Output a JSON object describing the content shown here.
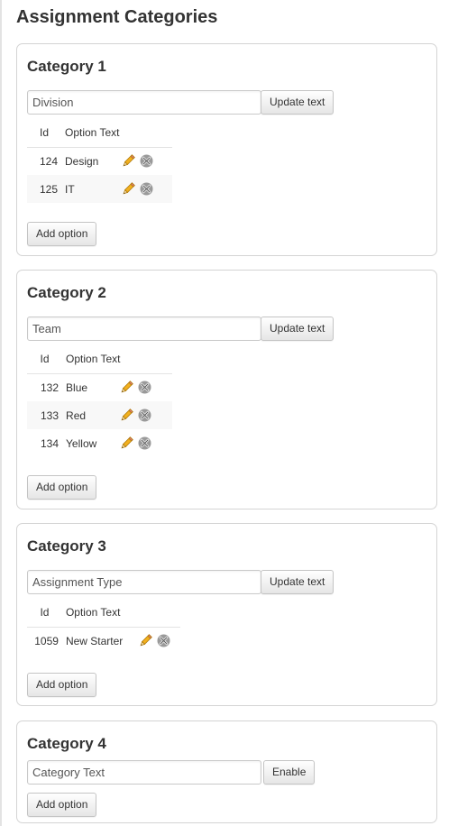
{
  "page": {
    "title": "Assignment Categories"
  },
  "labels": {
    "update_text": "Update text",
    "enable": "Enable",
    "add_option": "Add option",
    "col_id": "Id",
    "col_option_text": "Option Text"
  },
  "categories": [
    {
      "heading": "Category 1",
      "input_value": "Division",
      "options": [
        {
          "id": "124",
          "text": "Design"
        },
        {
          "id": "125",
          "text": "IT"
        }
      ]
    },
    {
      "heading": "Category 2",
      "input_value": "Team",
      "options": [
        {
          "id": "132",
          "text": "Blue"
        },
        {
          "id": "133",
          "text": "Red"
        },
        {
          "id": "134",
          "text": "Yellow"
        }
      ]
    },
    {
      "heading": "Category 3",
      "input_value": "Assignment Type",
      "options": [
        {
          "id": "1059",
          "text": "New Starter"
        }
      ]
    },
    {
      "heading": "Category 4",
      "input_value": "Category Text",
      "options": []
    }
  ],
  "icons": {
    "edit": "pencil-icon",
    "delete": "delete-x-icon"
  }
}
